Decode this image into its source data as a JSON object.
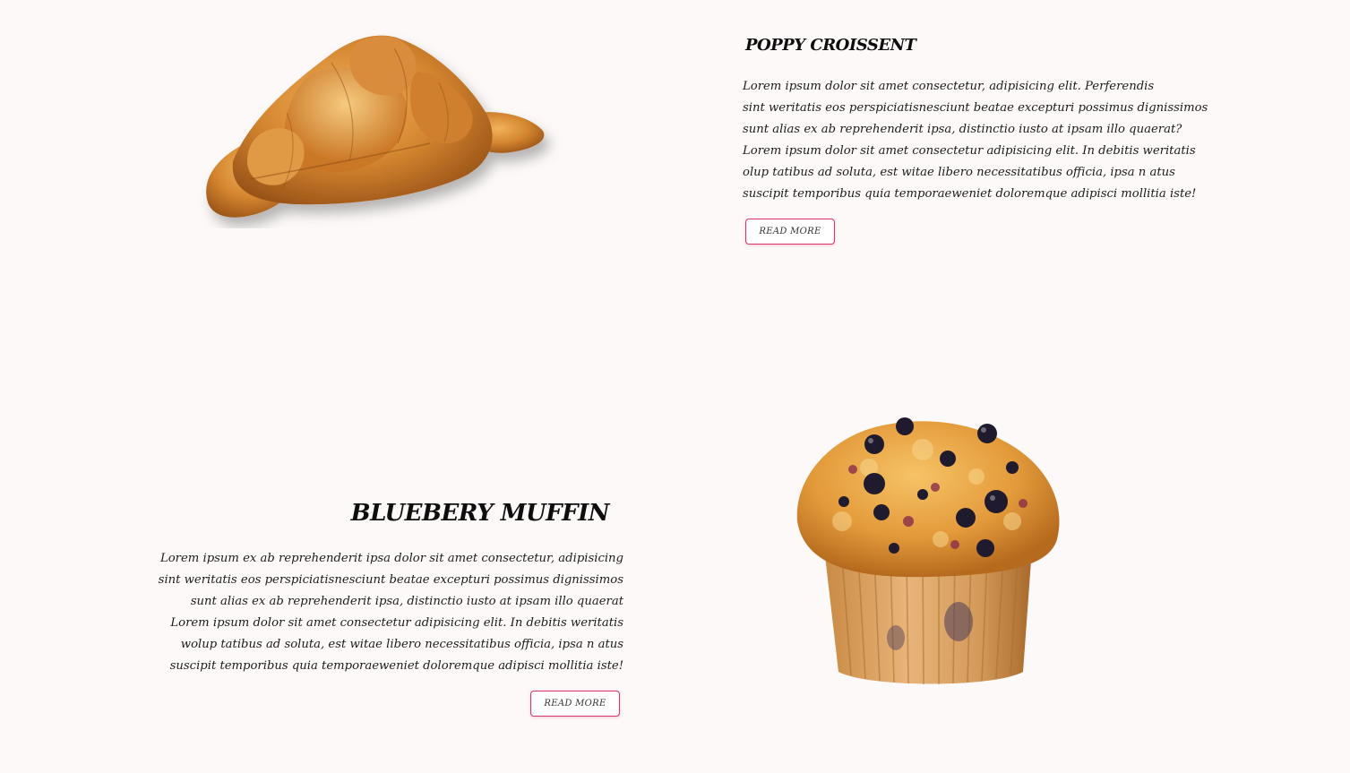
{
  "products": [
    {
      "title": "POPPY CROISSENT",
      "description_lines": [
        "Lorem ipsum dolor sit amet consectetur, adipisicing elit. Perferendis",
        "sint weritatis eos perspiciatisnesciunt beatae excepturi possimus dignissimos",
        "sunt alias ex ab reprehenderit ipsa, distinctio iusto at  ipsam illo quaerat?",
        "Lorem ipsum dolor sit amet consectetur adipisicing elit. In debitis weritatis",
        "olup tatibus ad soluta, est witae libero necessitatibus officia, ipsa n atus",
        "suscipit temporibus quia temporaeweniet doloremque adipisci mollitia iste!"
      ],
      "button_label": "READ MORE",
      "image_icon": "croissant-image"
    },
    {
      "title": "BLUEBERY MUFFIN",
      "description_lines": [
        "Lorem ipsum ex ab reprehenderit ipsa dolor sit amet consectetur, adipisicing",
        "sint weritatis eos perspiciatisnesciunt beatae excepturi possimus dignissimos",
        "sunt alias ex ab reprehenderit ipsa, distinctio iusto at  ipsam illo quaerat",
        "Lorem ipsum dolor sit amet consectetur adipisicing elit. In debitis weritatis",
        "wolup tatibus ad soluta, est witae libero necessitatibus officia, ipsa n atus",
        "suscipit temporibus quia temporaeweniet doloremque adipisci mollitia iste!"
      ],
      "button_label": "READ MORE",
      "image_icon": "muffin-image"
    }
  ],
  "colors": {
    "background": "#fdf9f9",
    "button_border": "#d6336c",
    "text": "#1c1c1c"
  }
}
